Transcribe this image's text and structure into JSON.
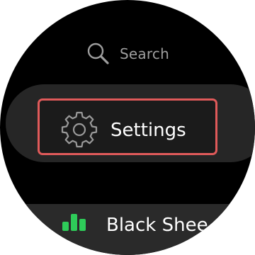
{
  "search": {
    "label": "Search",
    "icon": "search-icon"
  },
  "settings": {
    "label": "Settings",
    "icon": "gear-icon"
  },
  "media": {
    "label": "Black Shee",
    "icon": "audio-bars-icon"
  },
  "colors": {
    "background": "#000000",
    "chip": "#262626",
    "focus_border": "#e05a5a",
    "bars": "#2ecc59",
    "search_text": "#9e9e9e",
    "primary_text": "#ffffff"
  }
}
